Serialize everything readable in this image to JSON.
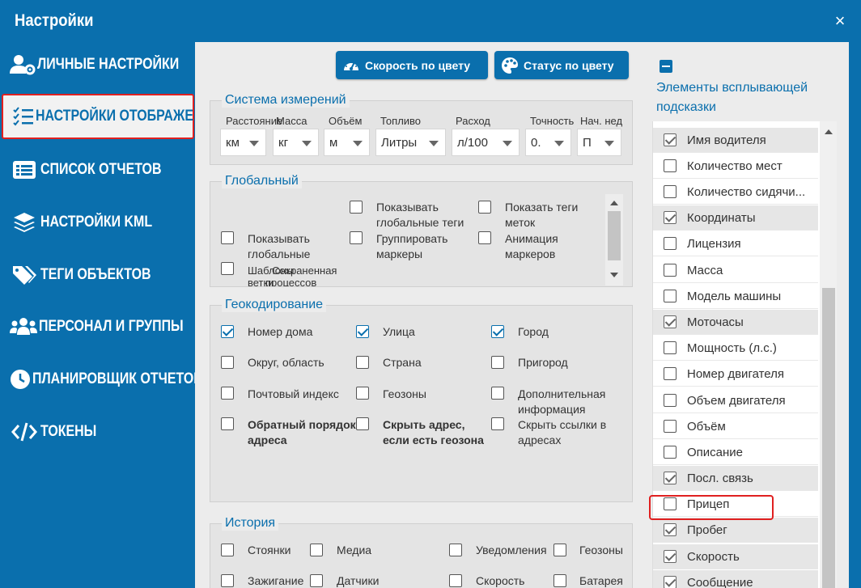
{
  "window": {
    "title": "Настройки",
    "close": "×"
  },
  "sidebar": {
    "items": [
      {
        "label": "ЛИЧНЫЕ НАСТРОЙКИ",
        "icon": "user-gear-icon"
      },
      {
        "label": "НАСТРОЙКИ ОТОБРАЖЕНИЯ",
        "icon": "list-check-icon",
        "active": true
      },
      {
        "label": "СПИСОК ОТЧЕТОВ",
        "icon": "list-icon"
      },
      {
        "label": "НАСТРОЙКИ KML",
        "icon": "layers-icon"
      },
      {
        "label": "ТЕГИ ОБЪЕКТОВ",
        "icon": "tags-icon"
      },
      {
        "label": "ПЕРСОНАЛ И ГРУППЫ",
        "icon": "users-icon"
      },
      {
        "label": "ПЛАНИРОВЩИК ОТЧЕТОВ",
        "icon": "clock-icon"
      },
      {
        "label": "ТОКЕНЫ",
        "icon": "code-icon"
      }
    ]
  },
  "toolbar": {
    "speed_color": "Скорость по цвету",
    "status_color": "Статус по цвету"
  },
  "units": {
    "title": "Система измерений",
    "labels": [
      "Расстояние",
      "Масса",
      "Объём",
      "Топливо",
      "Расход",
      "Точность",
      "Нач. нед"
    ],
    "values": [
      "км",
      "кг",
      "м",
      "Литры",
      "л/100",
      "0.",
      "П"
    ]
  },
  "global": {
    "title": "Глобальный",
    "items": [
      "Показывать глобальные теги",
      "Показать теги меток",
      "Показывать глобальные",
      "Группировать маркеры",
      "Анимация маркеров",
      "Шаблоны",
      "Сохраненная",
      "ветки",
      "процессов"
    ]
  },
  "geocoding": {
    "title": "Геокодирование",
    "items": [
      {
        "label": "Номер дома",
        "checked": true
      },
      {
        "label": "Улица",
        "checked": true
      },
      {
        "label": "Город",
        "checked": true
      },
      {
        "label": "Округ, область",
        "checked": false
      },
      {
        "label": "Страна",
        "checked": false
      },
      {
        "label": "Пригород",
        "checked": false
      },
      {
        "label": "Почтовый индекс",
        "checked": false
      },
      {
        "label": "Геозоны",
        "checked": false
      },
      {
        "label": "Дополнительная информация",
        "checked": false
      },
      {
        "label": "Обратный порядок адреса",
        "checked": false
      },
      {
        "label": "Скрыть адрес, если есть геозона",
        "checked": false
      },
      {
        "label": "Скрыть ссылки в адресах",
        "checked": false
      }
    ]
  },
  "history": {
    "title": "История",
    "items": [
      "Стоянки",
      "Медиа",
      "Уведомления",
      "Геозоны",
      "Зажигание",
      "Датчики",
      "Скорость",
      "Батарея"
    ]
  },
  "tooltip": {
    "title": "Элементы всплывающей подсказки",
    "items": [
      {
        "label": "Имя водителя",
        "checked": true
      },
      {
        "label": "Количество мест",
        "checked": false
      },
      {
        "label": "Количество сидячи...",
        "checked": false
      },
      {
        "label": "Координаты",
        "checked": true
      },
      {
        "label": "Лицензия",
        "checked": false
      },
      {
        "label": "Масса",
        "checked": false
      },
      {
        "label": "Модель машины",
        "checked": false
      },
      {
        "label": "Моточасы",
        "checked": true
      },
      {
        "label": "Мощность (л.с.)",
        "checked": false
      },
      {
        "label": "Номер двигателя",
        "checked": false
      },
      {
        "label": "Объем двигателя",
        "checked": false
      },
      {
        "label": "Объём",
        "checked": false
      },
      {
        "label": "Описание",
        "checked": false
      },
      {
        "label": "Посл. связь",
        "checked": true
      },
      {
        "label": "Прицеп",
        "checked": false
      },
      {
        "label": "Пробег",
        "checked": true
      },
      {
        "label": "Скорость",
        "checked": true
      },
      {
        "label": "Сообщение",
        "checked": true
      }
    ]
  }
}
